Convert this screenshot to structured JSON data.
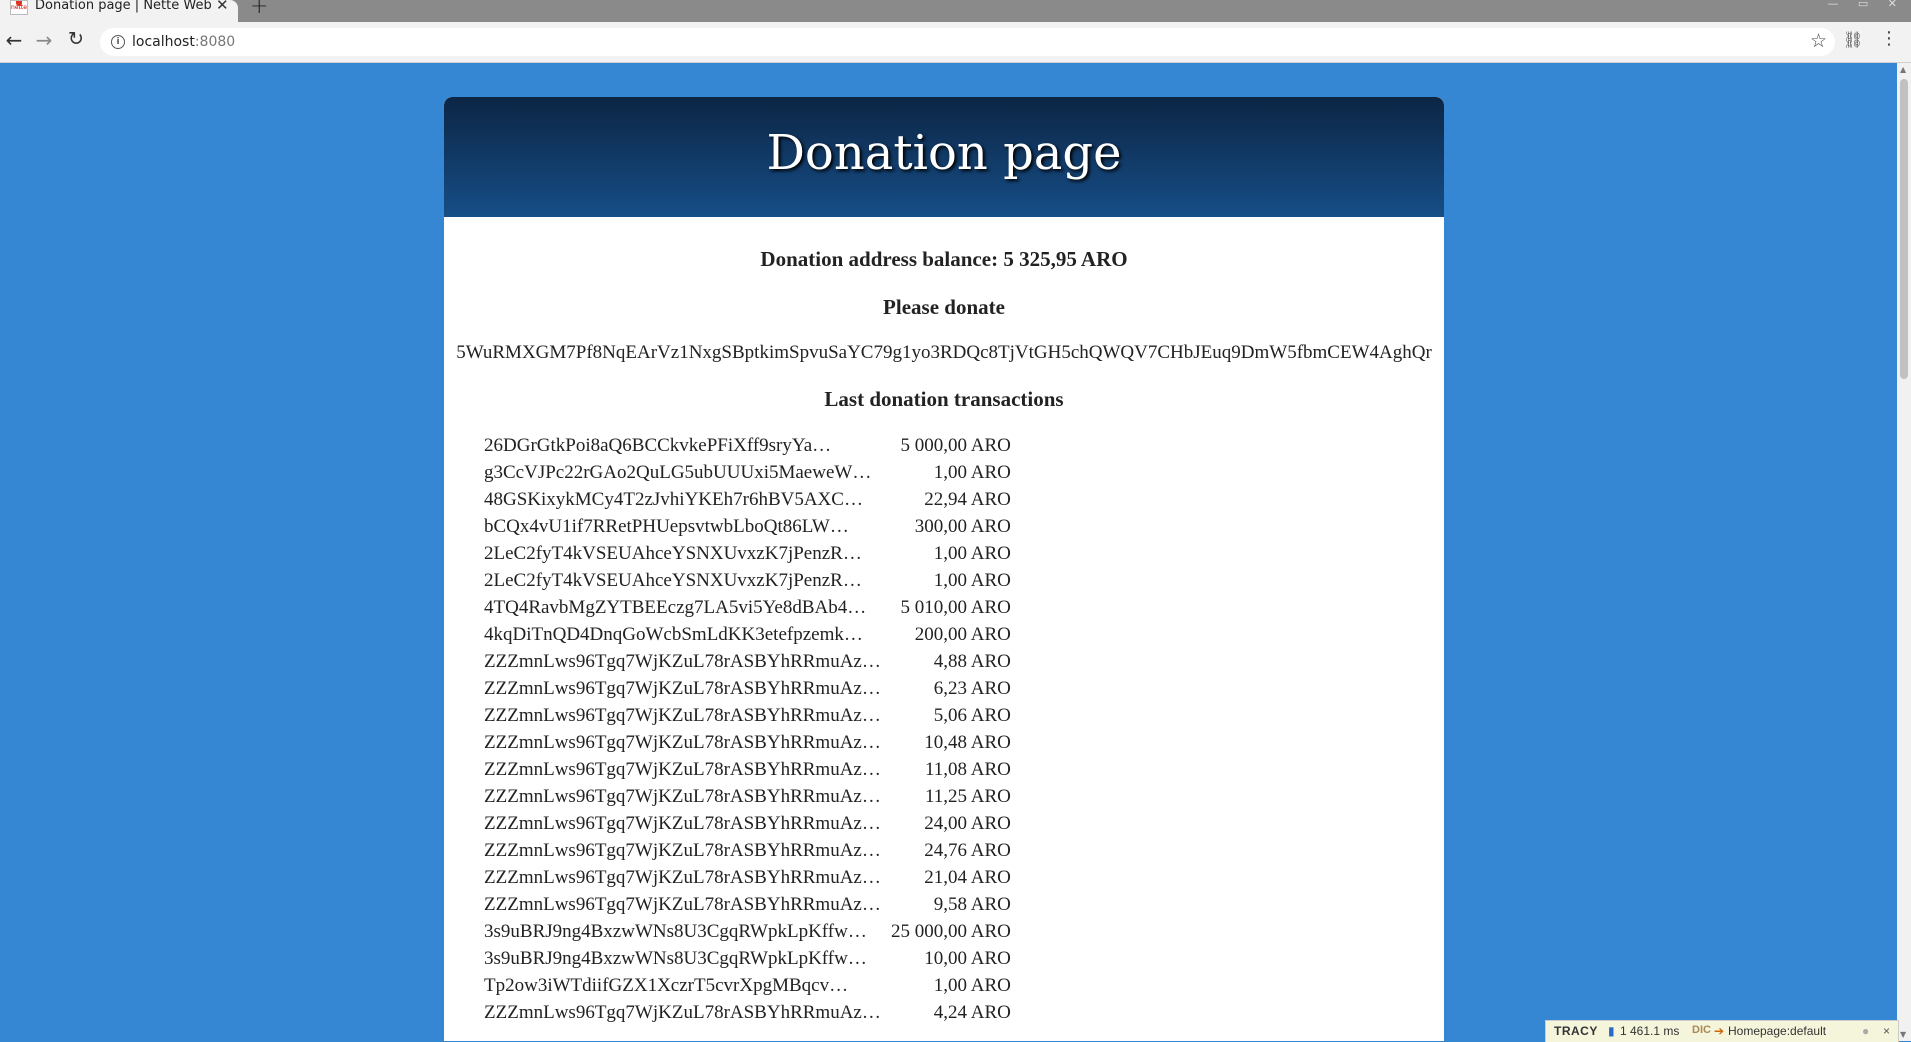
{
  "browser": {
    "tab_title": "Donation page | Nette Web",
    "tab_close": "✕",
    "new_tab": "+",
    "url_host": "localhost",
    "url_port": ":8080"
  },
  "page": {
    "header_title": "Donation page",
    "balance_text": "Donation address balance: 5 325,95 ARO",
    "please_donate": "Please donate",
    "donation_address": "5WuRMXGM7Pf8NqEArVz1NxgSBptkimSpvuSaYC79g1yo3RDQc8TjVtGH5chQWQV7CHbJEuq9DmW5fbmCEW4AghQr",
    "last_transactions_title": "Last donation transactions",
    "transactions": [
      {
        "hash": "26DGrGtkPoi8aQ6BCCkvkePFiXff9sryYa…",
        "amount": "5 000,00 ARO"
      },
      {
        "hash": "g3CcVJPc22rGAo2QuLG5ubUUUxi5MaeweW…",
        "amount": "1,00 ARO"
      },
      {
        "hash": "48GSKixykMCy4T2zJvhiYKEh7r6hBV5AXC…",
        "amount": "22,94 ARO"
      },
      {
        "hash": "bCQx4vU1if7RRetPHUepsvtwbLboQt86LW…",
        "amount": "300,00 ARO"
      },
      {
        "hash": "2LeC2fyT4kVSEUAhceYSNXUvxzK7jPenzR…",
        "amount": "1,00 ARO"
      },
      {
        "hash": "2LeC2fyT4kVSEUAhceYSNXUvxzK7jPenzR…",
        "amount": "1,00 ARO"
      },
      {
        "hash": "4TQ4RavbMgZYTBEEczg7LA5vi5Ye8dBAb4…",
        "amount": "5 010,00 ARO"
      },
      {
        "hash": "4kqDiTnQD4DnqGoWcbSmLdKK3etefpzemk…",
        "amount": "200,00 ARO"
      },
      {
        "hash": "ZZZmnLws96Tgq7WjKZuL78rASBYhRRmuAz…",
        "amount": "4,88 ARO"
      },
      {
        "hash": "ZZZmnLws96Tgq7WjKZuL78rASBYhRRmuAz…",
        "amount": "6,23 ARO"
      },
      {
        "hash": "ZZZmnLws96Tgq7WjKZuL78rASBYhRRmuAz…",
        "amount": "5,06 ARO"
      },
      {
        "hash": "ZZZmnLws96Tgq7WjKZuL78rASBYhRRmuAz…",
        "amount": "10,48 ARO"
      },
      {
        "hash": "ZZZmnLws96Tgq7WjKZuL78rASBYhRRmuAz…",
        "amount": "11,08 ARO"
      },
      {
        "hash": "ZZZmnLws96Tgq7WjKZuL78rASBYhRRmuAz…",
        "amount": "11,25 ARO"
      },
      {
        "hash": "ZZZmnLws96Tgq7WjKZuL78rASBYhRRmuAz…",
        "amount": "24,00 ARO"
      },
      {
        "hash": "ZZZmnLws96Tgq7WjKZuL78rASBYhRRmuAz…",
        "amount": "24,76 ARO"
      },
      {
        "hash": "ZZZmnLws96Tgq7WjKZuL78rASBYhRRmuAz…",
        "amount": "21,04 ARO"
      },
      {
        "hash": "ZZZmnLws96Tgq7WjKZuL78rASBYhRRmuAz…",
        "amount": "9,58 ARO"
      },
      {
        "hash": "3s9uBRJ9ng4BxzwWNs8U3CgqRWpkLpKffw…",
        "amount": "25 000,00 ARO"
      },
      {
        "hash": "3s9uBRJ9ng4BxzwWNs8U3CgqRWpkLpKffw…",
        "amount": "10,00 ARO"
      },
      {
        "hash": "Tp2ow3iWTdiifGZX1XczrT5cvrXpgMBqcv…",
        "amount": "1,00 ARO"
      },
      {
        "hash": "ZZZmnLws96Tgq7WjKZuL78rASBYhRRmuAz…",
        "amount": "4,24 ARO"
      }
    ]
  },
  "tracy": {
    "brand": "TRACY",
    "time": "1 461.1 ms",
    "db_label": "DIC",
    "route": "Homepage:default",
    "close": "×"
  },
  "colors": {
    "page_background": "#3586d3",
    "header_gradient_top": "#0c2544",
    "header_gradient_bottom": "#164e87"
  },
  "icons": {
    "back": "back-arrow-icon",
    "forward": "forward-arrow-icon",
    "reload": "reload-icon",
    "info": "info-icon",
    "bookmark": "star-icon",
    "extension": "extension-icon",
    "menu": "kebab-menu-icon"
  }
}
